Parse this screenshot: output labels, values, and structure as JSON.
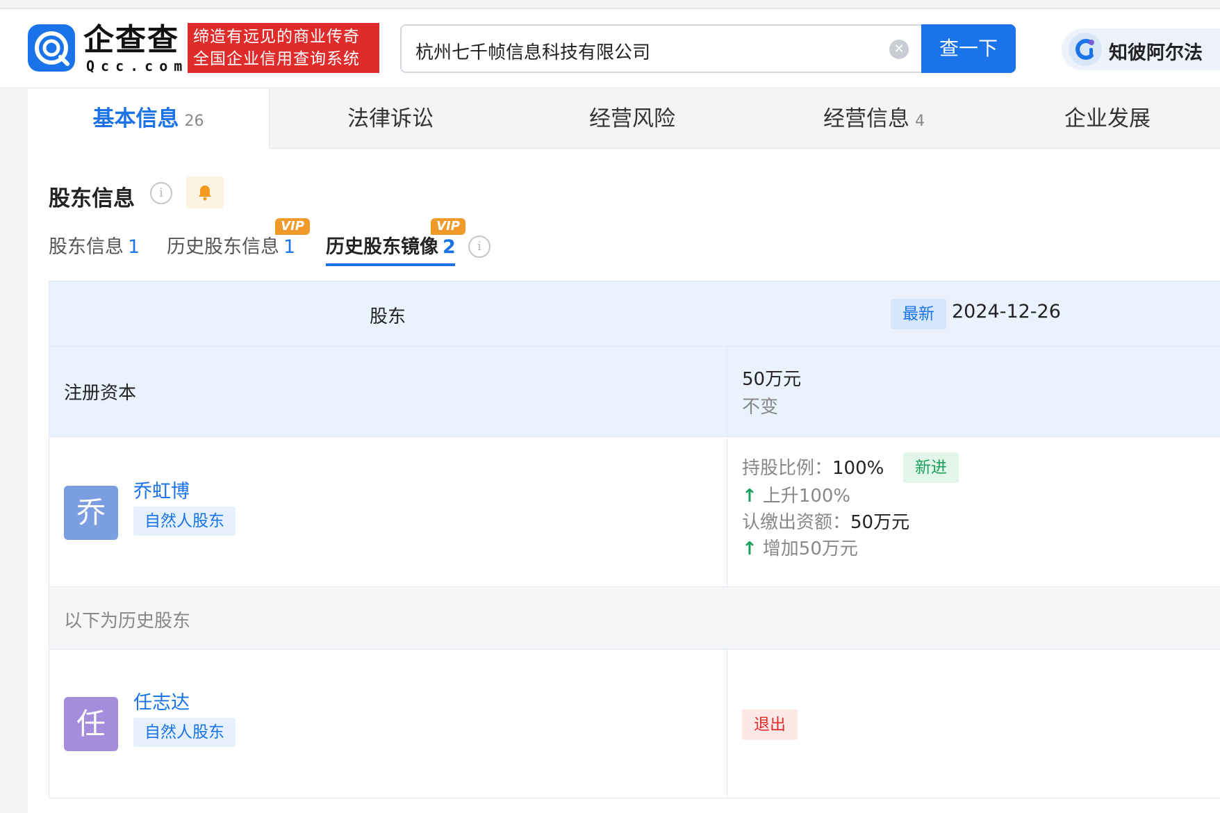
{
  "header": {
    "logo_cn": "企查查",
    "logo_en": "Qcc.com",
    "slogan_line1": "缔造有远见的商业传奇",
    "slogan_line2": "全国企业信用查询系统",
    "search_value": "杭州七千帧信息科技有限公司",
    "search_button": "查一下",
    "zhibi_label": "知彼阿尔法"
  },
  "tabs": [
    {
      "label": "基本信息",
      "count": "26"
    },
    {
      "label": "法律诉讼",
      "count": ""
    },
    {
      "label": "经营风险",
      "count": ""
    },
    {
      "label": "经营信息",
      "count": "4"
    },
    {
      "label": "企业发展",
      "count": ""
    }
  ],
  "section": {
    "title": "股东信息",
    "subtabs": [
      {
        "label": "股东信息",
        "count": "1"
      },
      {
        "label": "历史股东信息",
        "count": "1",
        "vip": "VIP"
      },
      {
        "label": "历史股东镜像",
        "count": "2",
        "vip": "VIP"
      }
    ]
  },
  "table": {
    "header_shareholder": "股东",
    "latest_tag": "最新",
    "date": "2024-12-26",
    "reg_capital_label": "注册资本",
    "reg_capital_value": "50万元",
    "reg_capital_change": "不变",
    "holders": [
      {
        "avatar_char": "乔",
        "avatar_color": "#7b9ee0",
        "name": "乔虹博",
        "type": "自然人股东",
        "ratio_label": "持股比例：",
        "ratio_value": "100%",
        "new_tag": "新进",
        "ratio_change": "上升100%",
        "subscribed_label": "认缴出资额：",
        "subscribed_value": "50万元",
        "subscribed_change": "增加50万元"
      }
    ],
    "history_label": "以下为历史股东",
    "history_holders": [
      {
        "avatar_char": "任",
        "avatar_color": "#a58ddc",
        "name": "任志达",
        "type": "自然人股东",
        "status": "退出"
      }
    ]
  },
  "colors": {
    "brand_blue": "#1a73e8",
    "slogan_red": "#e02b2b",
    "up_green": "#1aa05a",
    "vip_orange": "#f09a2a"
  },
  "icons": [
    "logo-mark-icon",
    "clear-icon",
    "zhibi-icon",
    "info-icon",
    "bell-icon",
    "arrow-up-icon"
  ]
}
